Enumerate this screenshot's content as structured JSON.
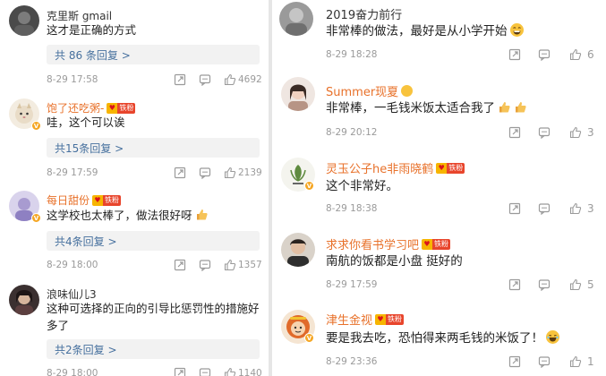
{
  "colors": {
    "orange_name": "#e8712a",
    "link_blue": "#46709e",
    "meta_gray": "#9a9a9a",
    "reply_bg": "#f2f2f2"
  },
  "left": {
    "comments": [
      {
        "name": "克里斯 gmail",
        "text": "这才是正确的方式",
        "replies": "共 86 条回复 >",
        "time": "8-29 17:58",
        "likes": "4692"
      },
      {
        "name": "饱了还吃粥-",
        "badge": "铁粉",
        "text": "哇，这个可以诶",
        "replies": "共15条回复 >",
        "time": "8-29 17:59",
        "likes": "2139"
      },
      {
        "name": "每日甜份",
        "badge": "铁粉",
        "text": "这学校也太棒了，做法很好呀",
        "replies": "共4条回复 >",
        "time": "8-29 18:00",
        "likes": "1357"
      },
      {
        "name": "浪味仙儿3",
        "text": "这种可选择的正向的引导比惩罚性的措施好多了",
        "replies": "共2条回复 >",
        "time": "8-29 18:00",
        "likes": "1140"
      }
    ]
  },
  "right": {
    "comments": [
      {
        "name": "2019奋力前行",
        "text": "非常棒的做法，最好是从小学开始",
        "emoji": "grin-emoji",
        "time": "8-29 18:28",
        "likes": "6"
      },
      {
        "name": "Summer现夏",
        "text": "非常棒，一毛钱米饭太适合我了",
        "emoji": "thumbs-up-emoji",
        "time": "8-29 20:12",
        "likes": "3"
      },
      {
        "name": "灵玉公子he非雨晓鹤",
        "badge": "铁粉",
        "text": "这个非常好。",
        "time": "8-29 18:38",
        "likes": "3"
      },
      {
        "name": "求求你看书学习吧",
        "badge": "铁粉",
        "text": "南航的饭都是小盘 挺好的",
        "time": "8-29 17:59",
        "likes": "5"
      },
      {
        "name": "津生金视",
        "badge": "铁粉",
        "text": "要是我去吃，恐怕得来两毛钱的米饭了！",
        "emoji": "laugh-emoji",
        "time": "8-29 23:36",
        "likes": "1"
      }
    ]
  }
}
